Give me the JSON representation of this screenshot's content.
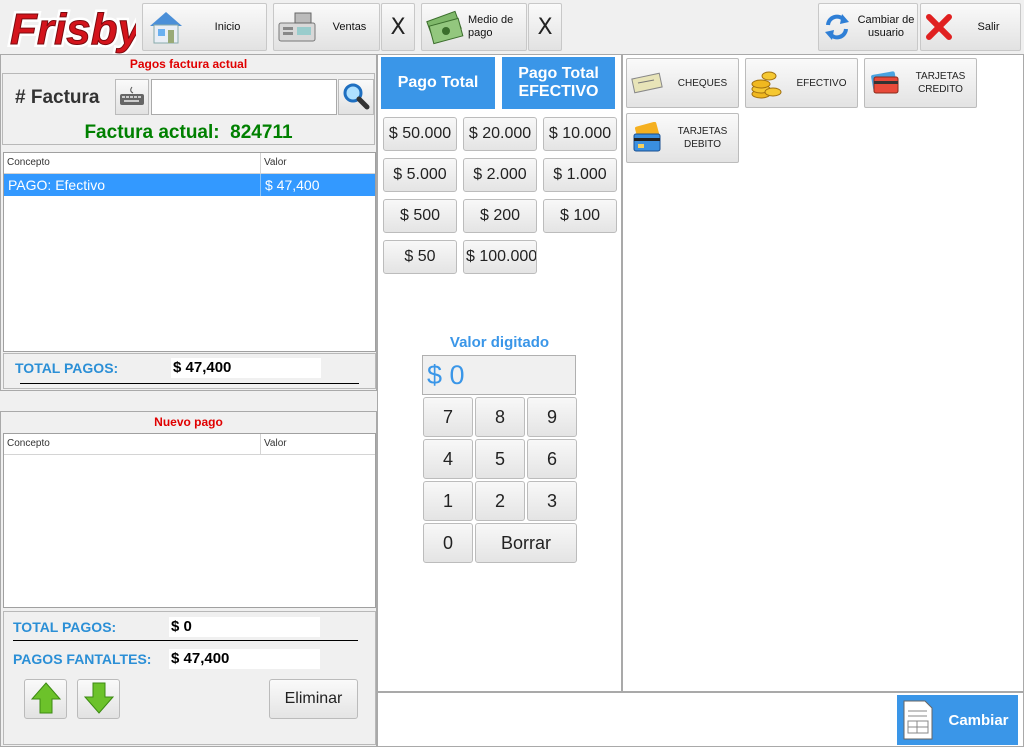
{
  "app": {
    "logo_text": "Frisby"
  },
  "toolbar": {
    "inicio": "Inicio",
    "ventas": "Ventas",
    "ventas_close": "X",
    "medio_pago": "Medio de pago",
    "medio_pago_close": "X",
    "cambiar_usuario": "Cambiar de usuario",
    "salir": "Salir"
  },
  "pagos_actual": {
    "title": "Pagos factura actual",
    "factura_label": "# Factura",
    "factura_input": "",
    "factura_actual_label": "Factura actual:",
    "factura_actual_value": "824711",
    "columns": [
      "Concepto",
      "Valor"
    ],
    "rows": [
      {
        "concepto": "PAGO: Efectivo",
        "valor": "$ 47,400"
      }
    ],
    "total_label": "TOTAL PAGOS:",
    "total_value": "$ 47,400"
  },
  "nuevo_pago": {
    "title": "Nuevo pago",
    "columns": [
      "Concepto",
      "Valor"
    ],
    "total_label": "TOTAL PAGOS:",
    "total_value": "$ 0",
    "faltantes_label": "PAGOS FANTALTES:",
    "faltantes_value": "$ 47,400",
    "eliminar": "Eliminar"
  },
  "amounts": {
    "pago_total": "Pago Total",
    "pago_total_efectivo": "Pago Total EFECTIVO",
    "denominations": [
      "$ 50.000",
      "$ 20.000",
      "$ 10.000",
      "$ 5.000",
      "$ 2.000",
      "$ 1.000",
      "$ 500",
      "$ 200",
      "$ 100",
      "$ 50",
      "$ 100.000"
    ]
  },
  "keypad": {
    "label": "Valor digitado",
    "display": "$ 0",
    "keys": [
      "7",
      "8",
      "9",
      "4",
      "5",
      "6",
      "1",
      "2",
      "3",
      "0"
    ],
    "borrar": "Borrar"
  },
  "methods": {
    "cheques": "CHEQUES",
    "efectivo": "EFECTIVO",
    "tarjetas_credito": "TARJETAS CREDITO",
    "tarjetas_debito": "TARJETAS DEBITO"
  },
  "footer": {
    "cambiar": "Cambiar"
  },
  "colors": {
    "accent_blue": "#3a96e8",
    "selected_row": "#3399ff",
    "title_red": "#e00000",
    "factura_green": "#008000",
    "total_blue": "#2b8fd6"
  }
}
